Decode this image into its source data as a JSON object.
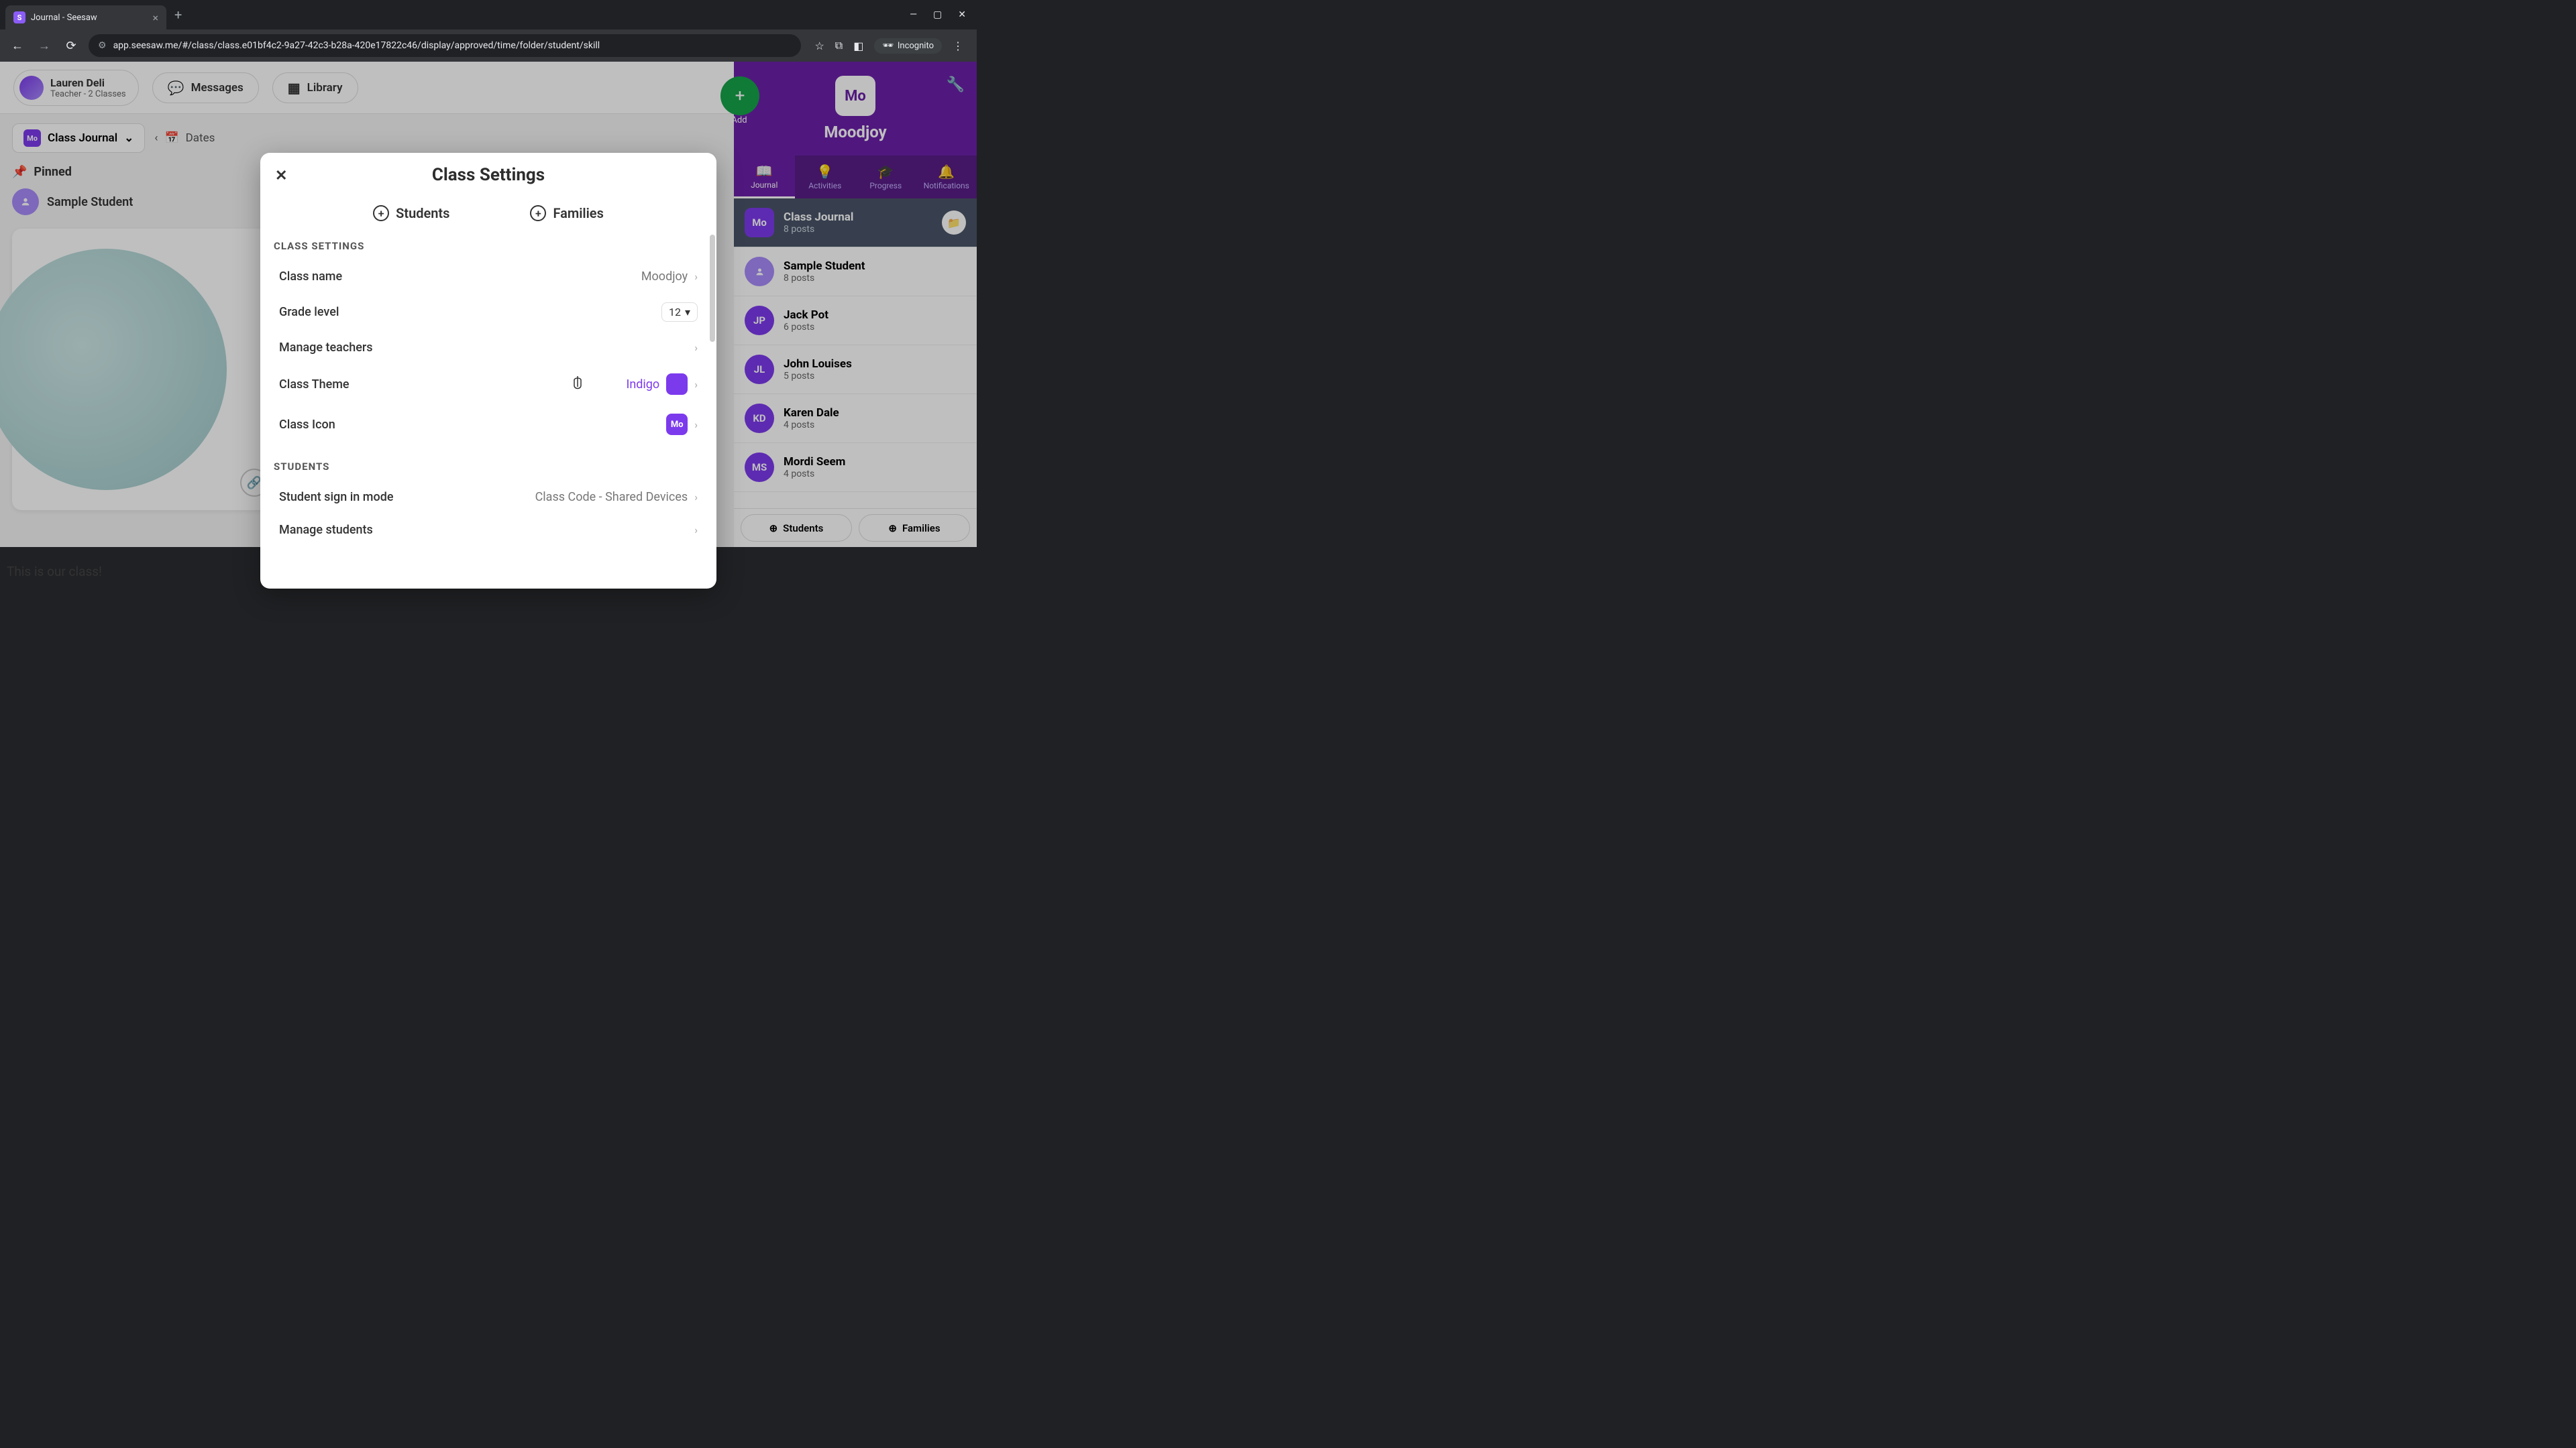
{
  "browser": {
    "tab_title": "Journal - Seesaw",
    "url": "app.seesaw.me/#/class/class.e01bf4c2-9a27-42c3-b28a-420e17822c46/display/approved/time/folder/student/skill",
    "incognito_label": "Incognito"
  },
  "header": {
    "user_name": "Lauren Deli",
    "user_role": "Teacher - 2 Classes",
    "messages_btn": "Messages",
    "library_btn": "Library"
  },
  "left": {
    "class_selector_label": "Class Journal",
    "class_badge": "Mo",
    "dates_label": "Dates",
    "pinned_label": "Pinned",
    "student_label": "Sample Student",
    "post_caption": "This is our class!"
  },
  "right": {
    "add_label": "Add",
    "class_badge": "Mo",
    "class_name": "Moodjoy",
    "tabs": [
      {
        "label": "Journal"
      },
      {
        "label": "Activities"
      },
      {
        "label": "Progress"
      },
      {
        "label": "Notifications"
      }
    ],
    "items": [
      {
        "badge": "Mo",
        "name": "Class Journal",
        "sub": "8 posts",
        "selected": true,
        "square": true
      },
      {
        "badge": "",
        "name": "Sample Student",
        "sub": "8 posts"
      },
      {
        "badge": "JP",
        "name": "Jack Pot",
        "sub": "6 posts"
      },
      {
        "badge": "JL",
        "name": "John Louises",
        "sub": "5 posts"
      },
      {
        "badge": "KD",
        "name": "Karen Dale",
        "sub": "4 posts"
      },
      {
        "badge": "MS",
        "name": "Mordi Seem",
        "sub": "4 posts"
      }
    ],
    "footer_students": "Students",
    "footer_families": "Families"
  },
  "modal": {
    "title": "Class Settings",
    "tab_students": "Students",
    "tab_families": "Families",
    "section_class": "CLASS SETTINGS",
    "section_students": "STUDENTS",
    "rows": {
      "class_name_label": "Class name",
      "class_name_value": "Moodjoy",
      "grade_label": "Grade level",
      "grade_value": "12",
      "manage_teachers": "Manage teachers",
      "theme_label": "Class Theme",
      "theme_value": "Indigo",
      "icon_label": "Class Icon",
      "icon_value": "Mo",
      "signin_label": "Student sign in mode",
      "signin_value": "Class Code - Shared Devices",
      "manage_students": "Manage students"
    }
  },
  "colors": {
    "indigo": "#7c3aed",
    "purple_header": "#6b21a8"
  }
}
